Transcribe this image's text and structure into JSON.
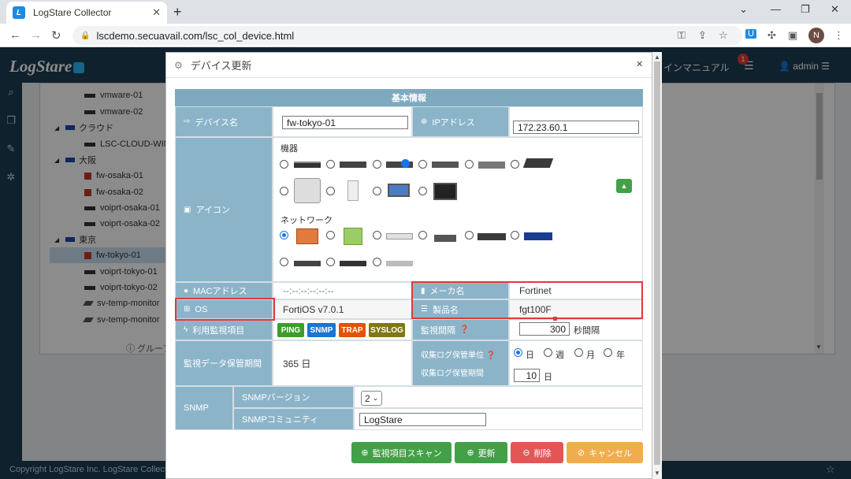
{
  "browser": {
    "tab_title": "LogStare Collector",
    "url": "lscdemo.secuavail.com/lsc_col_device.html",
    "profile_initial": "N"
  },
  "app": {
    "logo": "LogStare",
    "manual_label": "インマニュアル",
    "notification_count": "1",
    "user": "admin",
    "footer": "Copyright LogStare Inc. LogStare Collector",
    "group_button": "ⓘ グループ"
  },
  "tree": [
    {
      "label": "vmware-01",
      "kind": "dev"
    },
    {
      "label": "vmware-02",
      "kind": "dev"
    },
    {
      "label": "クラウド",
      "kind": "group"
    },
    {
      "label": "LSC-CLOUD-WIN",
      "kind": "dev"
    },
    {
      "label": "大阪",
      "kind": "group"
    },
    {
      "label": "fw-osaka-01",
      "kind": "fw"
    },
    {
      "label": "fw-osaka-02",
      "kind": "fw"
    },
    {
      "label": "voiprt-osaka-01",
      "kind": "dev"
    },
    {
      "label": "voiprt-osaka-02",
      "kind": "dev"
    },
    {
      "label": "東京",
      "kind": "group"
    },
    {
      "label": "fw-tokyo-01",
      "kind": "fw",
      "selected": true
    },
    {
      "label": "voiprt-tokyo-01",
      "kind": "dev"
    },
    {
      "label": "voiprt-tokyo-02",
      "kind": "dev"
    },
    {
      "label": "sv-temp-monitor",
      "kind": "sv"
    },
    {
      "label": "sv-temp-monitor",
      "kind": "sv"
    }
  ],
  "modal": {
    "title": "デバイス更新",
    "section_title": "基本情報",
    "device_name_label": "デバイス名",
    "device_name_value": "fw-tokyo-01",
    "ip_label": "IPアドレス",
    "ip_value": "172.23.60.1",
    "icon_label": "アイコン",
    "equipment_label": "機器",
    "network_label": "ネットワーク",
    "mac_label": "MACアドレス",
    "mac_value": "--:--:--:--:--:--",
    "maker_label": "メーカ名",
    "maker_value": "Fortinet",
    "os_label": "OS",
    "os_value": "FortiOS v7.0.1",
    "product_label": "製品名",
    "product_value": "fgt100F",
    "monitor_items_label": "利用監視項目",
    "tags": [
      "PING",
      "SNMP",
      "TRAP",
      "SYSLOG"
    ],
    "interval_label": "監視間隔",
    "interval_value": "300",
    "interval_unit": "秒間隔",
    "retention_label": "監視データ保管期間",
    "retention_value": "365 日",
    "log_unit_label": "収集ログ保管単位",
    "log_unit_options": [
      "日",
      "週",
      "月",
      "年"
    ],
    "log_period_label": "収集ログ保管期間",
    "log_period_value": "10",
    "log_period_unit": "日",
    "snmp_label": "SNMP",
    "snmp_version_label": "SNMPバージョン",
    "snmp_version_value": "2",
    "snmp_community_label": "SNMPコミュニティ",
    "snmp_community_value": "LogStare",
    "buttons": {
      "scan": "監視項目スキャン",
      "update": "更新",
      "delete": "削除",
      "cancel": "キャンセル"
    }
  },
  "colors": {
    "header": "#1d3d52",
    "label_bg": "#8bb4c9",
    "highlight": "#e53935",
    "btn_green": "#43a047",
    "btn_red": "#e35656",
    "btn_orange": "#f0ad4e"
  }
}
